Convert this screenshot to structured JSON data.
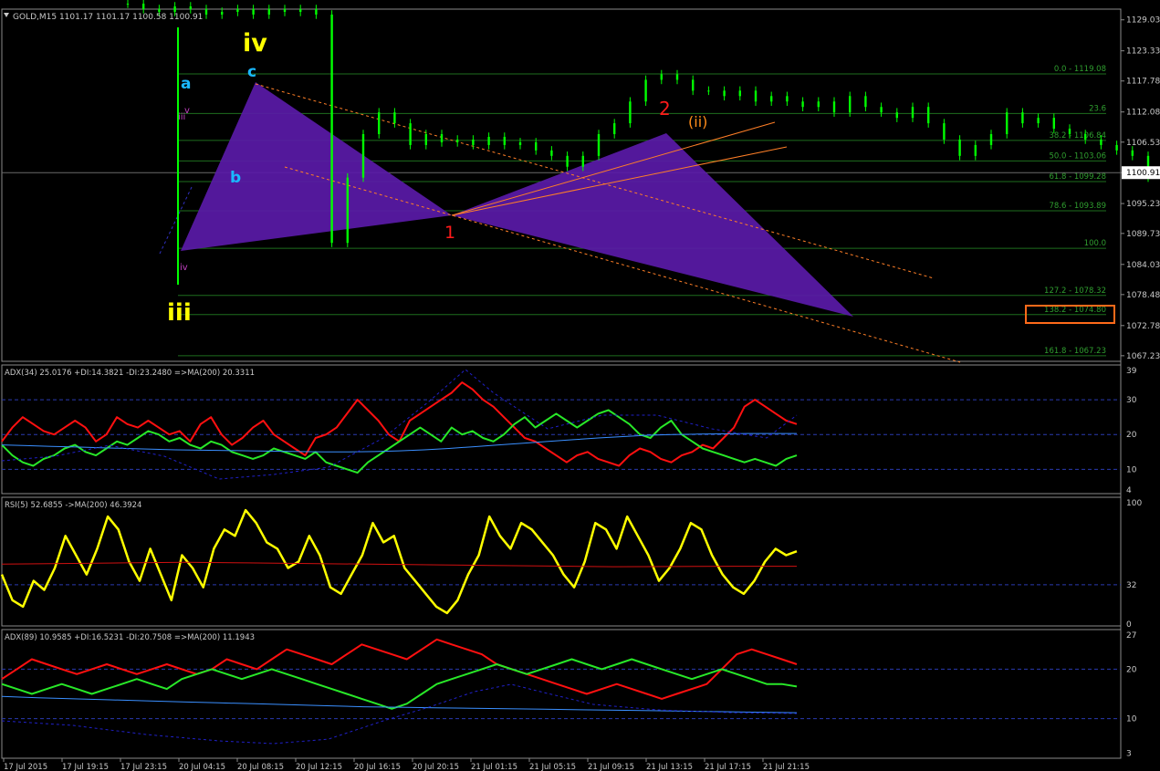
{
  "colors": {
    "background": "#000000",
    "candle": "#00ff00",
    "grid": "#1e6e1e",
    "axis_text": "#c8c8c8",
    "fib_text": "#2f9e2f",
    "pattern_fill": "#5a1aa8",
    "trend": "#ff7f27",
    "adx_red": "#ff1010",
    "adx_green": "#28e828",
    "ma_blue": "#3a8fff",
    "adx_dashed": "#2020c8",
    "rsi_yellow": "#ffff00",
    "rsi_ma": "#d01010",
    "wave_yellow": "#ffff00",
    "wave_cyan": "#1ab8ff",
    "wave_red": "#ff1a1a",
    "wave_orange": "#ff8c1a",
    "wave_magenta": "#c040c0",
    "highlight_box": "#ff6a1a"
  },
  "main": {
    "header": "GOLD,M15  1101.17 1101.17 1100.58 1100.91",
    "current_price": "1100.91",
    "wave_labels": {
      "iv": "iv",
      "iii": "iii",
      "a": "a",
      "b": "b",
      "c": "c",
      "one": "1",
      "two": "2",
      "ii_paren": "(ii)",
      "small_iii": "iii",
      "small_v": "v",
      "small_iv": "iv"
    },
    "highlight_label": "138.2 - 1074.80"
  },
  "chart_data": [
    {
      "type": "line",
      "title": "GOLD,M15",
      "x_ticks": [
        "17 Jul 2015",
        "17 Jul 19:15",
        "17 Jul 23:15",
        "20 Jul 04:15",
        "20 Jul 08:15",
        "20 Jul 12:15",
        "20 Jul 16:15",
        "20 Jul 20:15",
        "21 Jul 01:15",
        "21 Jul 05:15",
        "21 Jul 09:15",
        "21 Jul 13:15",
        "21 Jul 17:15",
        "21 Jul 21:15"
      ],
      "y_ticks": [
        "1129.03",
        "1123.33",
        "1117.78",
        "1112.08",
        "1106.53",
        "1100.91",
        "1095.23",
        "1089.73",
        "1084.03",
        "1078.48",
        "1072.78",
        "1067.23"
      ],
      "ylim": [
        1066.2,
        1131.0
      ],
      "fib_levels": [
        {
          "value": 1119.08,
          "label": "0.0 - 1119.08"
        },
        {
          "value": 1111.8,
          "label": "23.6"
        },
        {
          "value": 1106.84,
          "label": "38.2 - 1106.84"
        },
        {
          "value": 1103.06,
          "label": "50.0 - 1103.06"
        },
        {
          "value": 1099.28,
          "label": "61.8 - 1099.28"
        },
        {
          "value": 1093.89,
          "label": "78.6 - 1093.89"
        },
        {
          "value": 1087.0,
          "label": "100.0"
        },
        {
          "value": 1078.32,
          "label": "127.2 - 1078.32"
        },
        {
          "value": 1074.8,
          "label": "138.2 - 1074.80"
        },
        {
          "value": 1067.23,
          "label": "161.8 - 1067.23"
        }
      ],
      "series": [
        {
          "x": [
            0,
            4,
            8,
            12,
            16,
            20,
            24,
            28,
            32,
            36,
            40,
            44,
            48,
            52,
            56,
            60,
            64,
            68,
            72,
            76,
            80,
            84,
            88,
            92,
            96,
            100,
            104,
            108,
            112,
            116,
            120,
            124,
            128,
            132,
            136,
            140,
            144,
            148,
            152,
            156,
            160,
            164,
            168,
            172
          ],
          "y": [
            1132,
            1131,
            1130.5,
            1131.5,
            1131,
            1130,
            1130.5,
            1131,
            1130,
            1131,
            1130.5,
            1131,
            1130,
            1088,
            1100,
            1108,
            1112,
            1110,
            1106,
            1108,
            1106.5,
            1107,
            1106,
            1107.5,
            1106,
            1106.5,
            1105,
            1104,
            1102,
            1104,
            1108,
            1110,
            1114,
            1118,
            1119,
            1118,
            1116,
            1116,
            1115,
            1116,
            1114,
            1115,
            1114,
            1113
          ]
        },
        {
          "x": [
            176,
            180,
            184,
            188,
            192,
            196,
            200,
            204,
            208,
            212,
            216,
            220,
            224,
            228,
            232,
            236,
            240,
            244,
            248,
            252,
            256,
            260,
            264,
            268,
            272,
            276,
            280,
            284,
            288,
            292,
            296,
            300,
            304,
            308,
            312,
            316,
            320,
            324,
            328,
            332,
            336,
            340,
            344,
            348
          ],
          "y": [
            1114,
            1112,
            1115,
            1113,
            1112,
            1111,
            1113,
            1110,
            1107,
            1104,
            1106,
            1108,
            1112,
            1110,
            1111,
            1109,
            1108,
            1107,
            1106,
            1105,
            1104,
            1100,
            1095,
            1096,
            1097,
            1098,
            1097,
            1099,
            1098,
            1100,
            1102,
            1104,
            1103,
            1104,
            1104,
            1103,
            1103.5,
            1104,
            1103,
            1103.5,
            1104,
            1104,
            1103,
            1104
          ]
        },
        {
          "x": [
            352,
            356,
            360,
            364,
            368,
            372,
            376,
            380,
            384,
            388,
            392,
            396,
            400,
            404,
            408,
            412,
            416,
            420,
            424,
            428,
            432,
            436,
            440,
            444,
            448,
            452,
            456,
            460,
            464,
            468
          ],
          "y": [
            1103,
            1103.5,
            1104,
            1103,
            1103.5,
            1104,
            1103,
            1105,
            1107,
            1108,
            1108.5,
            1108,
            1108.5,
            1108,
            1107,
            1109,
            1110,
            1108,
            1106,
            1104,
            1103,
            1104,
            1104.5,
            1103,
            1102,
            1101,
            1100,
            1099,
            1100,
            1101
          ]
        }
      ]
    },
    {
      "type": "line",
      "title": "ADX(34) 25.0176  +DI:14.3821  -DI:23.2480  =>MA(200) 20.3311",
      "y_ticks": [
        "39",
        "30",
        "20",
        "10",
        "4"
      ],
      "ylim": [
        3,
        40
      ],
      "guide_levels": [
        30,
        20,
        10
      ],
      "series": [
        {
          "values": [
            18,
            22,
            25,
            23,
            21,
            20,
            22,
            24,
            22,
            18,
            20,
            25,
            23,
            22,
            24,
            22,
            20,
            21,
            18,
            23,
            25,
            20,
            17,
            19,
            22,
            24,
            20,
            18,
            16,
            14,
            19,
            20,
            22,
            26,
            30,
            27,
            24,
            20,
            18,
            24,
            26,
            28,
            30,
            32,
            35,
            33,
            30,
            28,
            25,
            22,
            19,
            18,
            16,
            14,
            12,
            14,
            15,
            13,
            12,
            11,
            14,
            16,
            15,
            13,
            12,
            14,
            15,
            17,
            16,
            19,
            22,
            28,
            30,
            28,
            26,
            24,
            23
          ]
        },
        {
          "values": [
            17,
            14,
            12,
            11,
            13,
            14,
            16,
            17,
            15,
            14,
            16,
            18,
            17,
            19,
            21,
            20,
            18,
            19,
            17,
            16,
            18,
            17,
            15,
            14,
            13,
            14,
            16,
            15,
            14,
            13,
            15,
            12,
            11,
            10,
            9,
            12,
            14,
            16,
            18,
            20,
            22,
            20,
            18,
            22,
            20,
            21,
            19,
            18,
            20,
            23,
            25,
            22,
            24,
            26,
            24,
            22,
            24,
            26,
            27,
            25,
            23,
            20,
            19,
            22,
            24,
            20,
            18,
            16,
            15,
            14,
            13,
            12,
            13,
            12,
            11,
            13,
            14
          ]
        },
        {
          "values": [
            17,
            16.8,
            16.6,
            16.4,
            16.2,
            16,
            15.8,
            15.6,
            15.5,
            15.4,
            15.3,
            15.2,
            15.1,
            15,
            15,
            15.1,
            15.3,
            15.6,
            16,
            16.5,
            17,
            17.5,
            18,
            18.5,
            19,
            19.4,
            19.8,
            20,
            20.1,
            20.2,
            20.3,
            20.3,
            20.3
          ]
        }
      ]
    },
    {
      "type": "line",
      "title": "RSI(5) 52.6855  ->MA(200) 46.3924",
      "y_ticks": [
        "100",
        "32",
        "0"
      ],
      "ylim": [
        0,
        100
      ],
      "guide_levels": [
        32
      ],
      "series": [
        {
          "values": [
            40,
            20,
            15,
            35,
            28,
            45,
            70,
            55,
            40,
            60,
            85,
            75,
            50,
            35,
            60,
            40,
            20,
            55,
            45,
            30,
            60,
            75,
            70,
            90,
            80,
            65,
            60,
            45,
            50,
            70,
            55,
            30,
            25,
            40,
            55,
            80,
            65,
            70,
            45,
            35,
            25,
            15,
            10,
            20,
            40,
            55,
            85,
            70,
            60,
            80,
            75,
            65,
            55,
            40,
            30,
            50,
            80,
            75,
            60,
            85,
            70,
            55,
            35,
            45,
            60,
            80,
            75,
            55,
            40,
            30,
            25,
            35,
            50,
            60,
            55,
            58
          ]
        },
        {
          "values": [
            48,
            48.5,
            49,
            49.5,
            49,
            48.5,
            48,
            47.5,
            47,
            46.5,
            46,
            46.2,
            46.4,
            46.4
          ]
        }
      ]
    },
    {
      "type": "line",
      "title": "ADX(89) 10.9585  +DI:16.5231  -DI:20.7508  =>MA(200) 11.1943",
      "y_ticks": [
        "27",
        "20",
        "10",
        "3"
      ],
      "ylim": [
        2,
        28
      ],
      "guide_levels": [
        20,
        10
      ],
      "series": [
        {
          "values": [
            18,
            20,
            22,
            21,
            20,
            19,
            20,
            21,
            20,
            19,
            20,
            21,
            20,
            19,
            20,
            22,
            21,
            20,
            22,
            24,
            23,
            22,
            21,
            23,
            25,
            24,
            23,
            22,
            24,
            26,
            25,
            24,
            23,
            21,
            20,
            19,
            18,
            17,
            16,
            15,
            16,
            17,
            16,
            15,
            14,
            15,
            16,
            17,
            20,
            23,
            24,
            23,
            22,
            21
          ]
        },
        {
          "values": [
            17,
            16,
            15,
            16,
            17,
            16,
            15,
            16,
            17,
            18,
            17,
            16,
            18,
            19,
            20,
            19,
            18,
            19,
            20,
            19,
            18,
            17,
            16,
            15,
            14,
            13,
            12,
            13,
            15,
            17,
            18,
            19,
            20,
            21,
            20,
            19,
            20,
            21,
            22,
            21,
            20,
            21,
            22,
            21,
            20,
            19,
            18,
            19,
            20,
            19,
            18,
            17,
            17,
            16.5
          ]
        },
        {
          "values": [
            14.5,
            14.2,
            14,
            13.8,
            13.6,
            13.4,
            13.2,
            13,
            12.8,
            12.6,
            12.4,
            12.3,
            12.2,
            12.1,
            12,
            11.9,
            11.8,
            11.7,
            11.6,
            11.5,
            11.4,
            11.3,
            11.2
          ]
        }
      ]
    }
  ]
}
